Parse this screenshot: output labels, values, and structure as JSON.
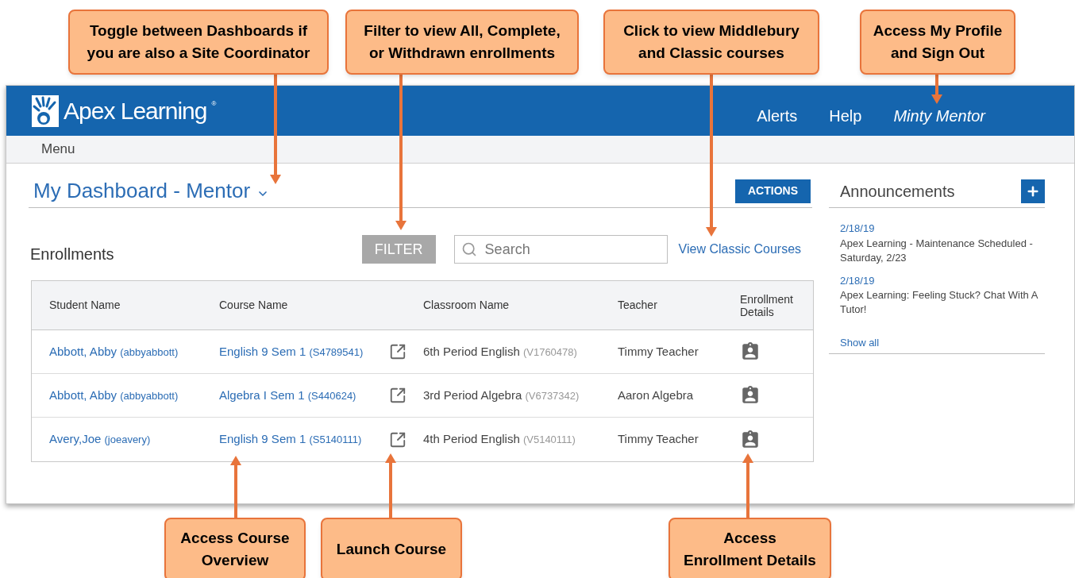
{
  "callouts": [
    {
      "lines": [
        "Toggle between Dashboards if",
        "you are also a Site Coordinator"
      ]
    },
    {
      "lines": [
        "Filter to view All, Complete,",
        "or Withdrawn enrollments"
      ]
    },
    {
      "lines": [
        "Click to view Middlebury",
        "and Classic courses"
      ]
    },
    {
      "lines": [
        "Access My Profile",
        "and Sign Out"
      ]
    },
    {
      "lines": [
        "Access Course",
        "Overview"
      ]
    },
    {
      "lines": [
        "Launch Course"
      ]
    },
    {
      "lines": [
        "Access",
        "Enrollment Details"
      ]
    }
  ],
  "header": {
    "brand": "Apex Learning",
    "brand_mark": "®",
    "nav": [
      "Alerts",
      "Help"
    ],
    "user": "Minty Mentor"
  },
  "menu_bar": {
    "label": "Menu"
  },
  "dashboard": {
    "title": "My Dashboard - Mentor",
    "actions_button": "ACTIONS"
  },
  "enrollments": {
    "title": "Enrollments",
    "filter_button": "FILTER",
    "search": {
      "placeholder": "Search"
    },
    "classic_link": "View Classic Courses",
    "columns": [
      "Student Name",
      "Course Name",
      "Classroom Name",
      "Teacher",
      "Enrollment Details"
    ],
    "rows": [
      {
        "student": "Abbott, Abby",
        "username": "(abbyabbott)",
        "course": "English 9 Sem 1",
        "course_code": "(S4789541)",
        "classroom": "6th Period English",
        "classroom_code": "(V1760478)",
        "teacher": "Timmy Teacher"
      },
      {
        "student": "Abbott, Abby",
        "username": "(abbyabbott)",
        "course": "Algebra I Sem 1",
        "course_code": "(S440624)",
        "classroom": "3rd Period Algebra",
        "classroom_code": "(V6737342)",
        "teacher": "Aaron Algebra"
      },
      {
        "student": "Avery,Joe",
        "username": "(joeavery)",
        "course": "English 9 Sem 1",
        "course_code": "(S5140111)",
        "classroom": "4th Period English",
        "classroom_code": "(V5140111)",
        "teacher": "Timmy Teacher"
      }
    ]
  },
  "announcements": {
    "title": "Announcements",
    "items": [
      {
        "date": "2/18/19",
        "text": "Apex Learning - Maintenance Scheduled - Saturday, 2/23"
      },
      {
        "date": "2/18/19",
        "text": "Apex Learning: Feeling Stuck? Chat With A Tutor!"
      }
    ],
    "show_all": "Show all"
  }
}
